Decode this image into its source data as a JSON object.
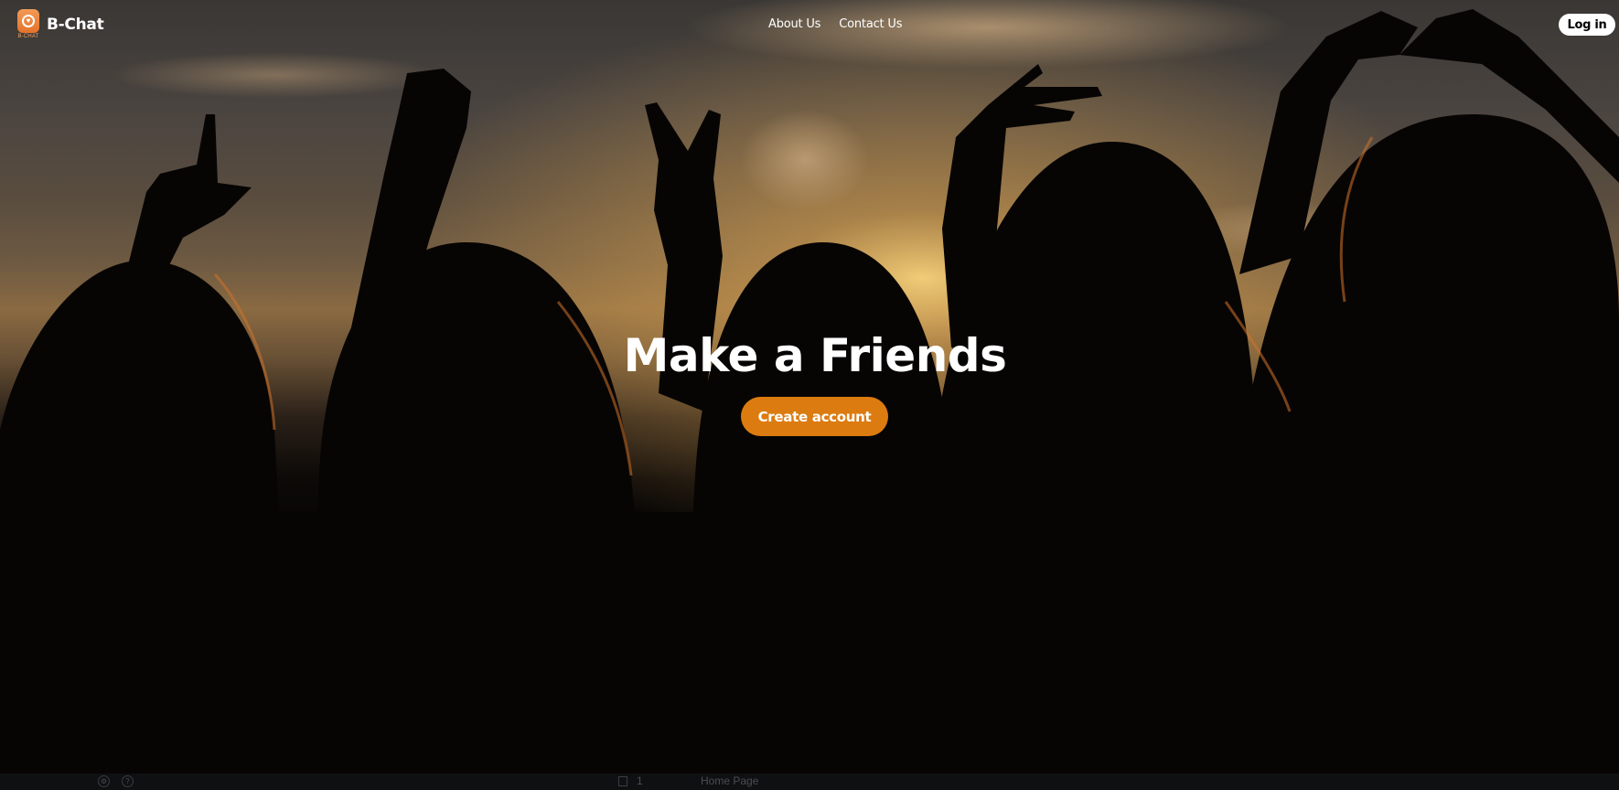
{
  "header": {
    "brand": "B-Chat",
    "logo_caption": "B-CHAT",
    "nav": [
      {
        "label": "About Us"
      },
      {
        "label": "Contact Us"
      }
    ],
    "login_label": "Log in"
  },
  "hero": {
    "headline": "Make a Friends",
    "cta_label": "Create account",
    "accent_color": "#dc7b0f"
  },
  "bottom_bar": {
    "page_number": "1",
    "page_label": "Home Page",
    "icons": [
      "settings-icon",
      "help-icon",
      "page-icon"
    ]
  }
}
